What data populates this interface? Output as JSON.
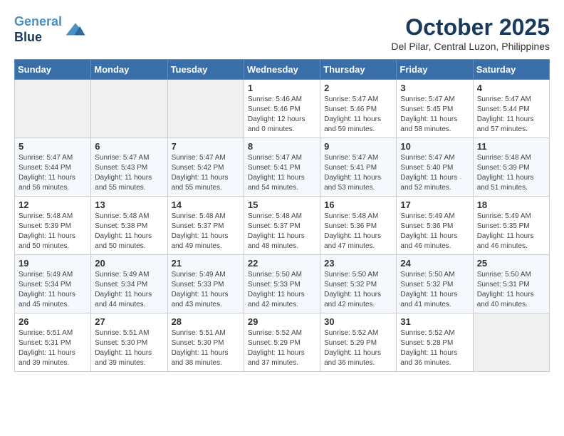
{
  "logo": {
    "line1": "General",
    "line2": "Blue"
  },
  "title": "October 2025",
  "location": "Del Pilar, Central Luzon, Philippines",
  "weekdays": [
    "Sunday",
    "Monday",
    "Tuesday",
    "Wednesday",
    "Thursday",
    "Friday",
    "Saturday"
  ],
  "weeks": [
    [
      {
        "day": "",
        "empty": true
      },
      {
        "day": "",
        "empty": true
      },
      {
        "day": "",
        "empty": true
      },
      {
        "day": "1",
        "sunrise": "5:46 AM",
        "sunset": "5:46 PM",
        "daylight": "12 hours and 0 minutes."
      },
      {
        "day": "2",
        "sunrise": "5:47 AM",
        "sunset": "5:46 PM",
        "daylight": "11 hours and 59 minutes."
      },
      {
        "day": "3",
        "sunrise": "5:47 AM",
        "sunset": "5:45 PM",
        "daylight": "11 hours and 58 minutes."
      },
      {
        "day": "4",
        "sunrise": "5:47 AM",
        "sunset": "5:44 PM",
        "daylight": "11 hours and 57 minutes."
      }
    ],
    [
      {
        "day": "5",
        "sunrise": "5:47 AM",
        "sunset": "5:44 PM",
        "daylight": "11 hours and 56 minutes."
      },
      {
        "day": "6",
        "sunrise": "5:47 AM",
        "sunset": "5:43 PM",
        "daylight": "11 hours and 55 minutes."
      },
      {
        "day": "7",
        "sunrise": "5:47 AM",
        "sunset": "5:42 PM",
        "daylight": "11 hours and 55 minutes."
      },
      {
        "day": "8",
        "sunrise": "5:47 AM",
        "sunset": "5:41 PM",
        "daylight": "11 hours and 54 minutes."
      },
      {
        "day": "9",
        "sunrise": "5:47 AM",
        "sunset": "5:41 PM",
        "daylight": "11 hours and 53 minutes."
      },
      {
        "day": "10",
        "sunrise": "5:47 AM",
        "sunset": "5:40 PM",
        "daylight": "11 hours and 52 minutes."
      },
      {
        "day": "11",
        "sunrise": "5:48 AM",
        "sunset": "5:39 PM",
        "daylight": "11 hours and 51 minutes."
      }
    ],
    [
      {
        "day": "12",
        "sunrise": "5:48 AM",
        "sunset": "5:39 PM",
        "daylight": "11 hours and 50 minutes."
      },
      {
        "day": "13",
        "sunrise": "5:48 AM",
        "sunset": "5:38 PM",
        "daylight": "11 hours and 50 minutes."
      },
      {
        "day": "14",
        "sunrise": "5:48 AM",
        "sunset": "5:37 PM",
        "daylight": "11 hours and 49 minutes."
      },
      {
        "day": "15",
        "sunrise": "5:48 AM",
        "sunset": "5:37 PM",
        "daylight": "11 hours and 48 minutes."
      },
      {
        "day": "16",
        "sunrise": "5:48 AM",
        "sunset": "5:36 PM",
        "daylight": "11 hours and 47 minutes."
      },
      {
        "day": "17",
        "sunrise": "5:49 AM",
        "sunset": "5:36 PM",
        "daylight": "11 hours and 46 minutes."
      },
      {
        "day": "18",
        "sunrise": "5:49 AM",
        "sunset": "5:35 PM",
        "daylight": "11 hours and 46 minutes."
      }
    ],
    [
      {
        "day": "19",
        "sunrise": "5:49 AM",
        "sunset": "5:34 PM",
        "daylight": "11 hours and 45 minutes."
      },
      {
        "day": "20",
        "sunrise": "5:49 AM",
        "sunset": "5:34 PM",
        "daylight": "11 hours and 44 minutes."
      },
      {
        "day": "21",
        "sunrise": "5:49 AM",
        "sunset": "5:33 PM",
        "daylight": "11 hours and 43 minutes."
      },
      {
        "day": "22",
        "sunrise": "5:50 AM",
        "sunset": "5:33 PM",
        "daylight": "11 hours and 42 minutes."
      },
      {
        "day": "23",
        "sunrise": "5:50 AM",
        "sunset": "5:32 PM",
        "daylight": "11 hours and 42 minutes."
      },
      {
        "day": "24",
        "sunrise": "5:50 AM",
        "sunset": "5:32 PM",
        "daylight": "11 hours and 41 minutes."
      },
      {
        "day": "25",
        "sunrise": "5:50 AM",
        "sunset": "5:31 PM",
        "daylight": "11 hours and 40 minutes."
      }
    ],
    [
      {
        "day": "26",
        "sunrise": "5:51 AM",
        "sunset": "5:31 PM",
        "daylight": "11 hours and 39 minutes."
      },
      {
        "day": "27",
        "sunrise": "5:51 AM",
        "sunset": "5:30 PM",
        "daylight": "11 hours and 39 minutes."
      },
      {
        "day": "28",
        "sunrise": "5:51 AM",
        "sunset": "5:30 PM",
        "daylight": "11 hours and 38 minutes."
      },
      {
        "day": "29",
        "sunrise": "5:52 AM",
        "sunset": "5:29 PM",
        "daylight": "11 hours and 37 minutes."
      },
      {
        "day": "30",
        "sunrise": "5:52 AM",
        "sunset": "5:29 PM",
        "daylight": "11 hours and 36 minutes."
      },
      {
        "day": "31",
        "sunrise": "5:52 AM",
        "sunset": "5:28 PM",
        "daylight": "11 hours and 36 minutes."
      },
      {
        "day": "",
        "empty": true
      }
    ]
  ],
  "labels": {
    "sunrise": "Sunrise:",
    "sunset": "Sunset:",
    "daylight": "Daylight:"
  }
}
